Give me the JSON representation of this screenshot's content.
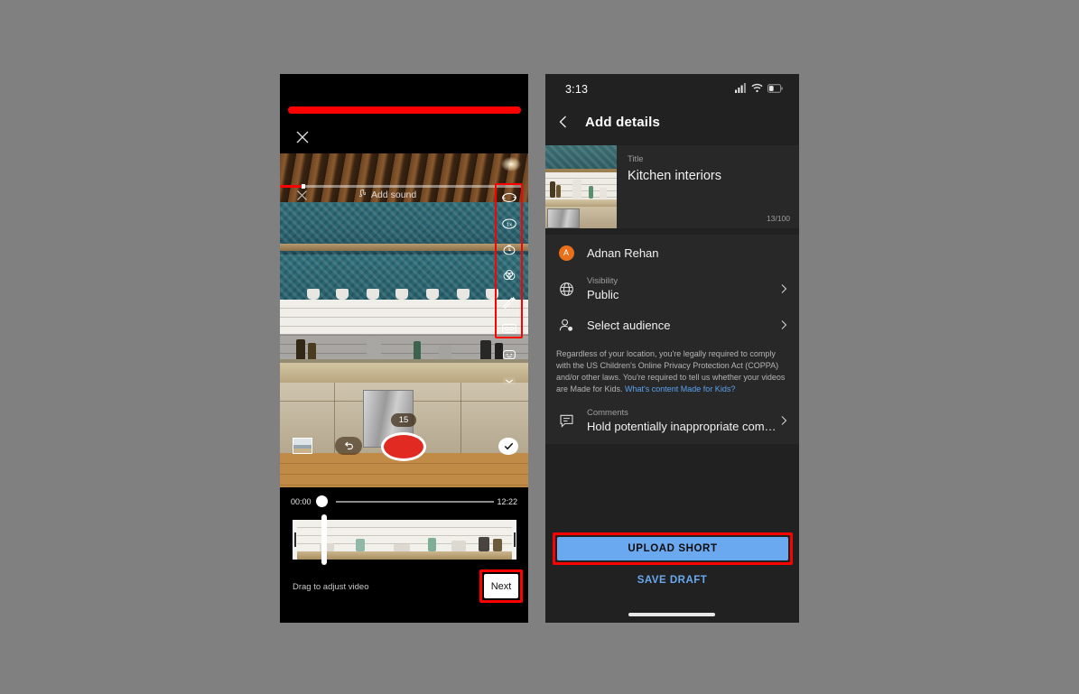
{
  "left_phone": {
    "close_icon": "close-x-icon",
    "sound_bar": {
      "label": "Add sound",
      "music_icon": "music-note-icon",
      "close_icon": "close-x-icon"
    },
    "tools": [
      {
        "name": "flip-camera-icon",
        "label": "Flip camera"
      },
      {
        "name": "speed-icon",
        "label": "1x"
      },
      {
        "name": "timer-icon",
        "label": "Timer"
      },
      {
        "name": "filters-icon",
        "label": "Filters"
      },
      {
        "name": "retouch-icon",
        "label": "Retouch"
      },
      {
        "name": "green-screen-icon",
        "label": "Green screen"
      },
      {
        "name": "effects-icon",
        "label": "Effects"
      },
      {
        "name": "chevron-down-icon",
        "label": "More"
      }
    ],
    "capture": {
      "duration_badge": "15",
      "record_label": "Record",
      "undo_label": "Undo",
      "gallery_label": "Gallery",
      "done_label": "Done"
    },
    "timeline": {
      "start_time": "00:00",
      "end_time": "12:22"
    },
    "trim": {
      "hint": "Drag to adjust video"
    },
    "next_button": "Next"
  },
  "right_phone": {
    "status_bar": {
      "clock": "3:13",
      "signal_icon": "cellular-signal-icon",
      "wifi_icon": "wifi-icon",
      "battery_icon": "battery-icon"
    },
    "appbar": {
      "back_icon": "back-chevron-icon",
      "title": "Add details"
    },
    "title_card": {
      "label": "Title",
      "value": "Kitchen interiors",
      "counter": "13/100",
      "thumbnail_name": "video-thumbnail"
    },
    "account": {
      "avatar_initial": "A",
      "avatar_color": "#e8701a",
      "name": "Adnan Rehan"
    },
    "visibility": {
      "icon": "globe-icon",
      "label": "Visibility",
      "value": "Public",
      "chevron": "chevron-right-icon"
    },
    "audience": {
      "icon": "person-add-icon",
      "label": "Select audience",
      "chevron": "chevron-right-icon"
    },
    "legal": {
      "text": "Regardless of your location, you're legally required to comply with the US Children's Online Privacy Protection Act (COPPA) and/or other laws. You're required to tell us whether your videos are Made for Kids. ",
      "link": "What's content Made for Kids?"
    },
    "comments": {
      "icon": "comment-bubble-icon",
      "label": "Comments",
      "value": "Hold potentially inappropriate com…",
      "chevron": "chevron-right-icon"
    },
    "upload_button": "UPLOAD SHORT",
    "save_draft_button": "SAVE DRAFT"
  },
  "annotations": {
    "accent_color": "#ff0000",
    "top_bar_name": "red-highlight-bar",
    "tools_box_name": "red-highlight-tools",
    "next_box_name": "red-highlight-next",
    "upload_box_name": "red-highlight-upload"
  }
}
